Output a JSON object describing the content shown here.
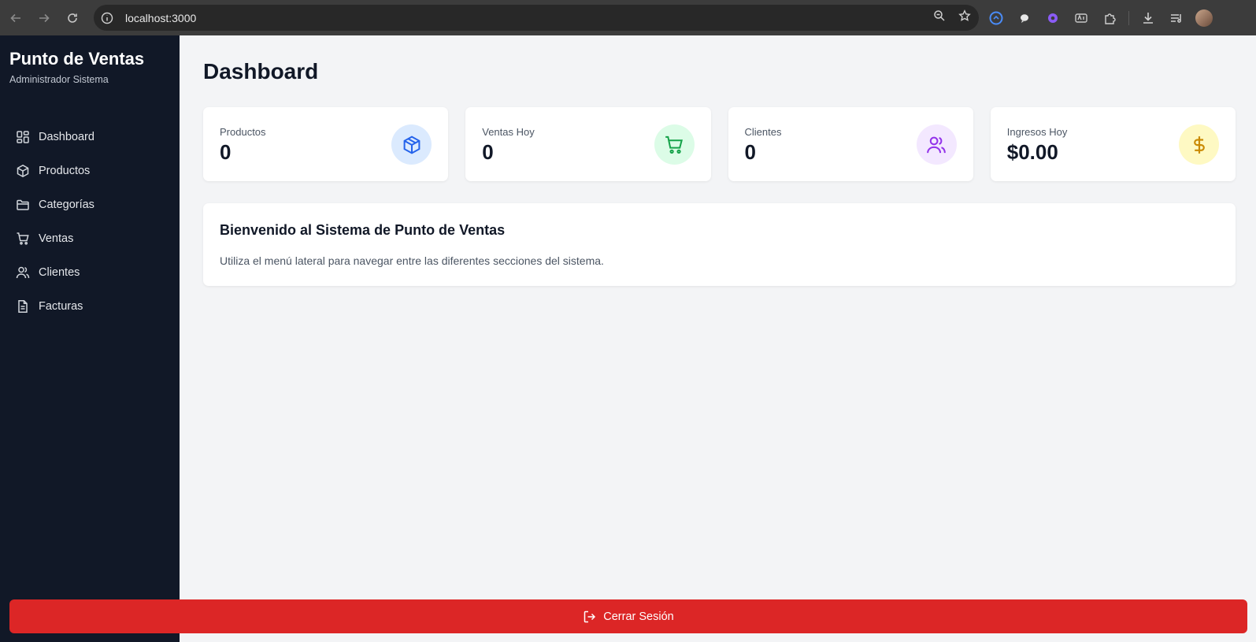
{
  "browser": {
    "url": "localhost:3000",
    "icons": [
      "back-icon",
      "forward-icon",
      "reload-icon",
      "site-info-icon",
      "zoom-icon",
      "bookmark-star-icon",
      "extension-icon",
      "puzzle-icon",
      "download-icon",
      "media-icon",
      "profile-avatar"
    ]
  },
  "sidebar": {
    "title": "Punto de Ventas",
    "subtitle": "Administrador Sistema",
    "items": [
      {
        "label": "Dashboard",
        "icon": "dashboard-grid-icon"
      },
      {
        "label": "Productos",
        "icon": "box-icon"
      },
      {
        "label": "Categorías",
        "icon": "folder-icon"
      },
      {
        "label": "Ventas",
        "icon": "cart-icon"
      },
      {
        "label": "Clientes",
        "icon": "users-icon"
      },
      {
        "label": "Facturas",
        "icon": "document-icon"
      }
    ],
    "logout_label": "Cerrar Sesión"
  },
  "main": {
    "title": "Dashboard",
    "stats": [
      {
        "label": "Productos",
        "value": "0",
        "icon": "box-icon",
        "color": "#2563eb",
        "bg": "#dbeafe"
      },
      {
        "label": "Ventas Hoy",
        "value": "0",
        "icon": "cart-icon",
        "color": "#16a34a",
        "bg": "#dcfce7"
      },
      {
        "label": "Clientes",
        "value": "0",
        "icon": "users-icon",
        "color": "#9333ea",
        "bg": "#f3e8ff"
      },
      {
        "label": "Ingresos Hoy",
        "value": "$0.00",
        "icon": "dollar-icon",
        "color": "#ca8a04",
        "bg": "#fef9c3"
      }
    ],
    "welcome": {
      "title": "Bienvenido al Sistema de Punto de Ventas",
      "text": "Utiliza el menú lateral para navegar entre las diferentes secciones del sistema."
    }
  },
  "colors": {
    "sidebar_bg": "#111827",
    "page_bg": "#f3f4f6",
    "logout_bg": "#dc2626"
  }
}
